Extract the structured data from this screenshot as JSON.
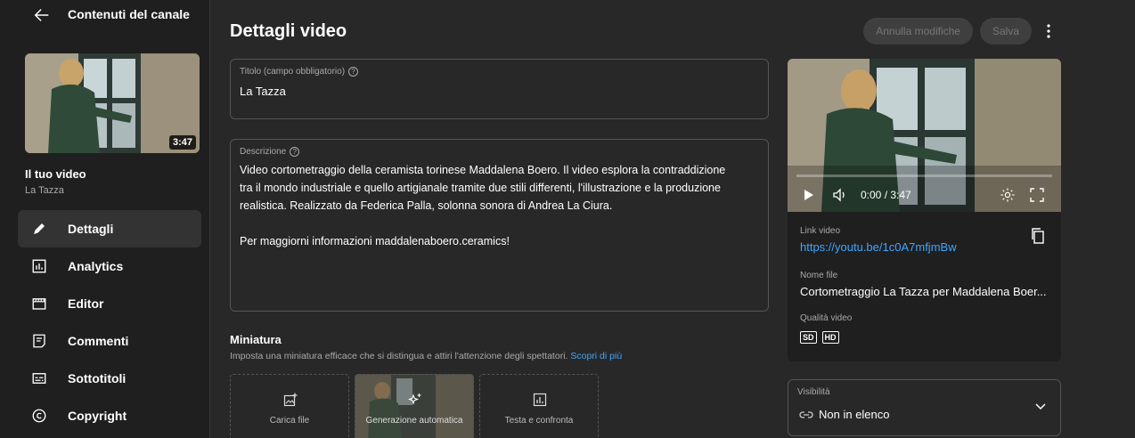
{
  "sidebar": {
    "back_title": "Contenuti del canale",
    "thumb_duration": "3:47",
    "your_video": "Il tuo video",
    "video_name": "La Tazza",
    "items": [
      {
        "label": "Dettagli",
        "icon": "pencil-icon",
        "active": true
      },
      {
        "label": "Analytics",
        "icon": "analytics-icon"
      },
      {
        "label": "Editor",
        "icon": "clapperboard-icon"
      },
      {
        "label": "Commenti",
        "icon": "comment-icon"
      },
      {
        "label": "Sottotitoli",
        "icon": "subtitles-icon"
      },
      {
        "label": "Copyright",
        "icon": "copyright-icon"
      }
    ]
  },
  "header": {
    "title": "Dettagli video",
    "discard_label": "Annulla modifiche",
    "save_label": "Salva"
  },
  "title_field": {
    "label": "Titolo (campo obbligatorio)",
    "value": "La Tazza"
  },
  "description_field": {
    "label": "Descrizione",
    "line1": "Video cortometraggio della ceramista torinese Maddalena Boero. Il video esplora la contraddizione",
    "line2": "tra il mondo industriale e quello artigianale tramite due stili differenti, l'illustrazione e la produzione",
    "line3": "realistica. Realizzato da Federica Palla, solonna sonora di Andrea La Ciura.",
    "line4": "Per maggiorni informazioni maddalenaboero.ceramics!"
  },
  "thumbnail": {
    "title": "Miniatura",
    "subtitle": "Imposta una miniatura efficace che si distingua e attiri l'attenzione degli spettatori.",
    "learn_more": "Scopri di più",
    "tiles": [
      "Carica file",
      "Generazione automatica",
      "Testa e confronta"
    ]
  },
  "player": {
    "time": "0:00 / 3:47",
    "progress": 0
  },
  "video_info": {
    "link_label": "Link video",
    "link": "https://youtu.be/1c0A7mfjmBw",
    "filename_label": "Nome file",
    "filename": "Cortometraggio La Tazza per Maddalena Boer...",
    "quality_label": "Qualità video",
    "qualities": [
      "SD",
      "HD"
    ]
  },
  "visibility": {
    "label": "Visibilità",
    "value": "Non in elenco"
  },
  "colors": {
    "background": "#282828",
    "sidebar": "#1f1f1f",
    "link": "#3ea6ff",
    "text": "#ffffff",
    "muted": "#aaaaaa"
  }
}
